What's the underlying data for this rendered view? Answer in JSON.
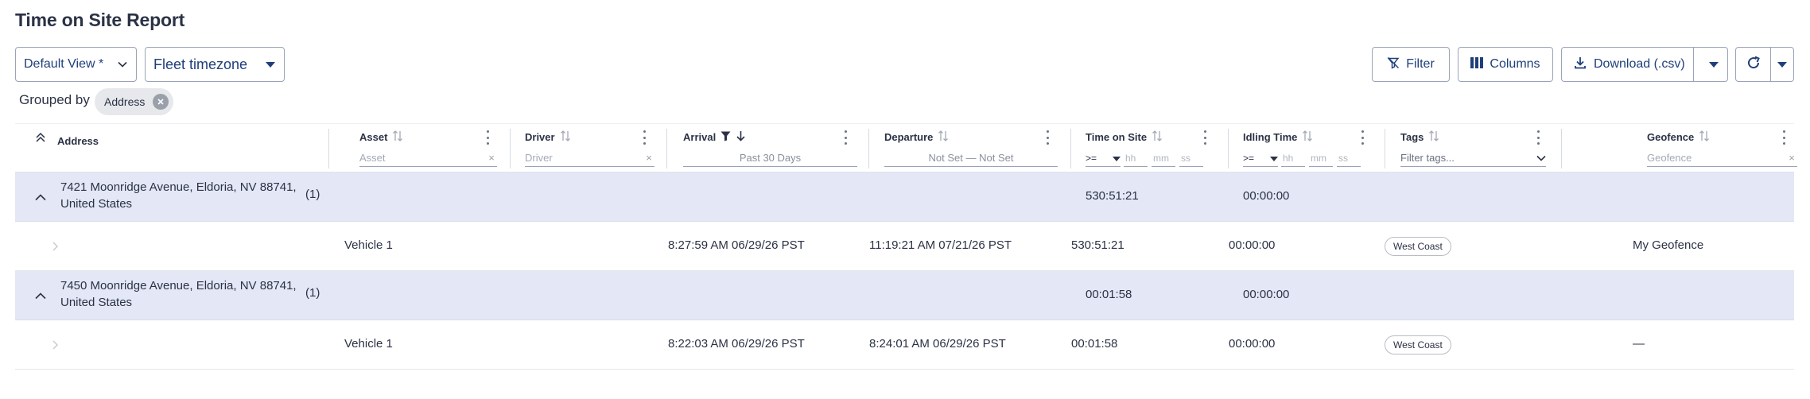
{
  "page": {
    "title": "Time on Site Report"
  },
  "controls": {
    "view": "Default View *",
    "timezone": "Fleet timezone",
    "filter_label": "Filter",
    "columns_label": "Columns",
    "download_label": "Download (.csv)"
  },
  "grouping": {
    "label": "Grouped by",
    "chip": "Address"
  },
  "columns": {
    "address": "Address",
    "asset": "Asset",
    "driver": "Driver",
    "arrival": "Arrival",
    "departure": "Departure",
    "time_on_site": "Time on Site",
    "idling_time": "Idling Time",
    "tags": "Tags",
    "geofence": "Geofence"
  },
  "filters": {
    "asset_placeholder": "Asset",
    "driver_placeholder": "Driver",
    "arrival_value": "Past 30 Days",
    "departure_value": "Not Set — Not Set",
    "time_on_site_op": ">=",
    "idling_op": ">=",
    "hh": "hh",
    "mm": "mm",
    "ss": "ss",
    "tags_placeholder": "Filter tags...",
    "geofence_placeholder": "Geofence"
  },
  "groups": [
    {
      "address": "7421 Moonridge Avenue, Eldoria, NV 88741, United States",
      "count": "(1)",
      "time_on_site": "530:51:21",
      "idling_time": "00:00:00",
      "rows": [
        {
          "asset": "Vehicle 1",
          "arrival": "8:27:59 AM 06/29/26 PST",
          "departure": "11:19:21 AM 07/21/26 PST",
          "time_on_site": "530:51:21",
          "idling_time": "00:00:00",
          "tag": "West Coast",
          "geofence": "My Geofence"
        }
      ]
    },
    {
      "address": "7450 Moonridge Avenue, Eldoria, NV 88741, United States",
      "count": "(1)",
      "time_on_site": "00:01:58",
      "idling_time": "00:00:00",
      "rows": [
        {
          "asset": "Vehicle 1",
          "arrival": "8:22:03 AM 06/29/26 PST",
          "departure": "8:24:01 AM 06/29/26 PST",
          "time_on_site": "00:01:58",
          "idling_time": "00:00:00",
          "tag": "West Coast",
          "geofence": "—"
        }
      ]
    }
  ],
  "theme": {
    "accent": "#1f3f7a",
    "group_row_bg": "#e3e7f6",
    "text": "#2b3245"
  }
}
